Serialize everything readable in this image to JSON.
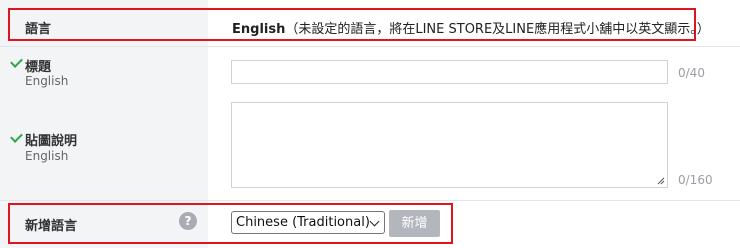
{
  "language_row": {
    "label": "語言",
    "value_bold": "English",
    "value_note": "（未設定的語言，將在LINE STORE及LINE應用程式小舖中以英文顯示。）"
  },
  "title_row": {
    "label": "標題",
    "sublabel": "English",
    "value": "",
    "counter": "0/40"
  },
  "description_row": {
    "label": "貼圖說明",
    "sublabel": "English",
    "value": "",
    "counter": "0/160"
  },
  "add_language_row": {
    "label": "新增語言",
    "help_icon": "?",
    "selected_language": "Chinese (Traditional)",
    "add_button": "新增"
  },
  "colors": {
    "highlight": "#e0141e",
    "check": "#2ba84a",
    "button_disabled": "#b3b7bd"
  }
}
